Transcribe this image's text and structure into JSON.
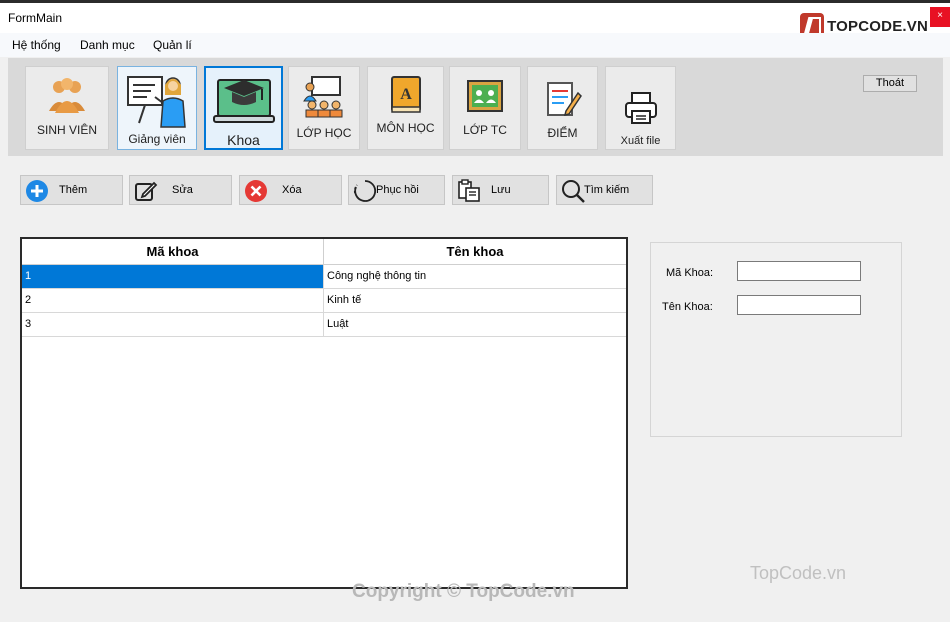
{
  "window": {
    "title": "FormMain",
    "close_glyph": "×"
  },
  "logo": {
    "text": "TOPCODE.VN"
  },
  "menu": [
    {
      "label": "Hệ thống"
    },
    {
      "label": "Danh mục"
    },
    {
      "label": "Quản lí"
    }
  ],
  "toolbar": {
    "buttons": [
      {
        "label": "SINH VIÊN",
        "icon": "students-icon"
      },
      {
        "label": "Giảng viên",
        "icon": "teacher-icon"
      },
      {
        "label": "Khoa",
        "icon": "graduation-laptop-icon",
        "active": true
      },
      {
        "label": "LỚP HỌC",
        "icon": "classroom-icon"
      },
      {
        "label": "MÔN HỌC",
        "icon": "book-icon"
      },
      {
        "label": "LỚP TC",
        "icon": "chalkboard-icon"
      },
      {
        "label": "ĐIỂM",
        "icon": "grade-sheet-icon"
      },
      {
        "label": "Xuất file",
        "icon": "printer-icon"
      }
    ],
    "exit_label": "Thoát"
  },
  "actions": [
    {
      "label": "Thêm",
      "icon": "plus-icon"
    },
    {
      "label": "Sửa",
      "icon": "edit-icon"
    },
    {
      "label": "Xóa",
      "icon": "delete-icon"
    },
    {
      "label": "Phục hồi",
      "icon": "restore-icon"
    },
    {
      "label": "Lưu",
      "icon": "save-icon"
    },
    {
      "label": "Tìm kiếm",
      "icon": "search-icon"
    }
  ],
  "grid": {
    "columns": [
      "Mã khoa",
      "Tên khoa"
    ],
    "rows": [
      [
        "1",
        "Công nghệ thông tin"
      ],
      [
        "2",
        "Kinh tế"
      ],
      [
        "3",
        "Luật"
      ]
    ],
    "selected_row": 0
  },
  "form": {
    "ma_khoa_label": "Mã Khoa:",
    "ten_khoa_label": "Tên Khoa:",
    "ma_khoa_value": "",
    "ten_khoa_value": ""
  },
  "watermarks": {
    "right": "TopCode.vn",
    "bottom": "Copyright © TopCode.vn"
  },
  "colors": {
    "accent": "#0078d7",
    "close": "#e81123",
    "plus": "#1e88e5",
    "delete": "#e53935"
  }
}
